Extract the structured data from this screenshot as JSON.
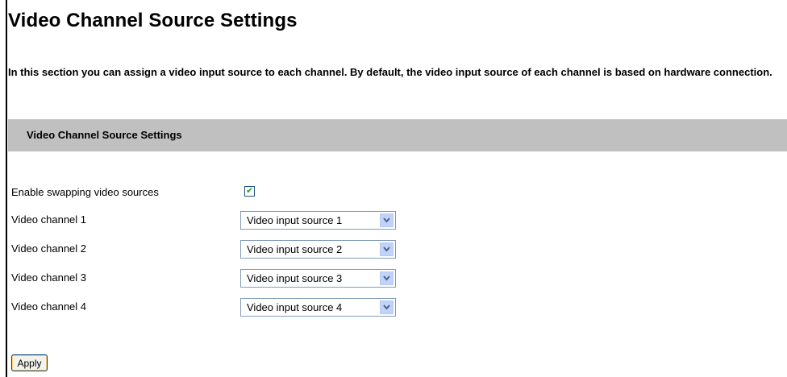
{
  "page": {
    "title": "Video Channel Source Settings",
    "intro": "In this section you can assign a video input source to each channel. By default, the video input source of each channel is based on hardware connection."
  },
  "section": {
    "title": "Video Channel Source Settings",
    "swap": {
      "label": "Enable swapping video sources",
      "checked": true
    },
    "channels": [
      {
        "label": "Video channel 1",
        "value": "Video input source 1"
      },
      {
        "label": "Video channel 2",
        "value": "Video input source 2"
      },
      {
        "label": "Video channel 3",
        "value": "Video input source 3"
      },
      {
        "label": "Video channel 4",
        "value": "Video input source 4"
      }
    ]
  },
  "apply_label": "Apply",
  "icons": {
    "checkbox": "checkmark-icon",
    "dropdown": "chevron-down-icon"
  },
  "colors": {
    "section_bar": "#c0c0c0",
    "checkmark": "#21a121",
    "dropdown_button": "#c1d3fb",
    "dropdown_arrow": "#4d6185"
  }
}
